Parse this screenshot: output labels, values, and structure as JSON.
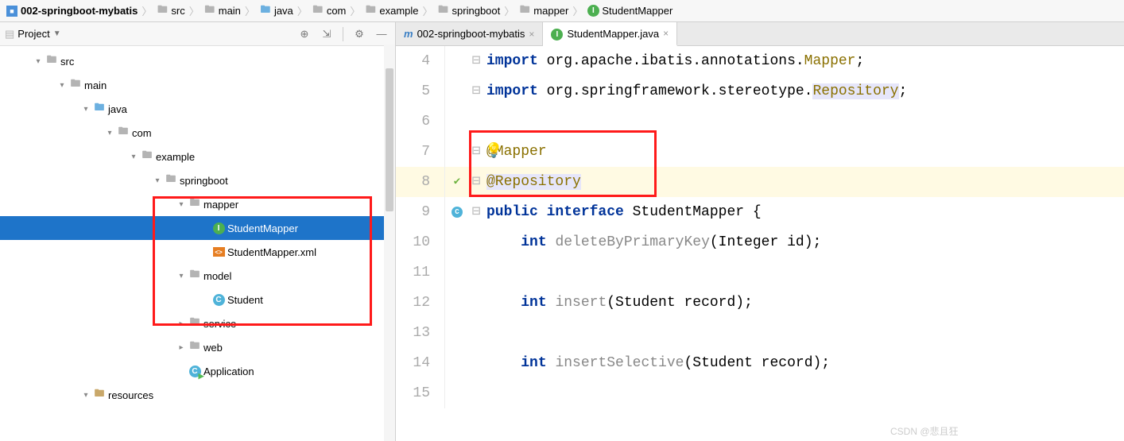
{
  "breadcrumb": [
    {
      "icon": "module",
      "label": "002-springboot-mybatis",
      "bold": true
    },
    {
      "icon": "folder",
      "label": "src"
    },
    {
      "icon": "folder",
      "label": "main"
    },
    {
      "icon": "folder-blue",
      "label": "java"
    },
    {
      "icon": "folder",
      "label": "com"
    },
    {
      "icon": "folder",
      "label": "example"
    },
    {
      "icon": "folder",
      "label": "springboot"
    },
    {
      "icon": "folder",
      "label": "mapper"
    },
    {
      "icon": "interface",
      "label": "StudentMapper"
    }
  ],
  "project_panel": {
    "title": "Project"
  },
  "tree": [
    {
      "depth": 0,
      "arrow": "down",
      "icon": "folder",
      "label": "src"
    },
    {
      "depth": 1,
      "arrow": "down",
      "icon": "folder",
      "label": "main"
    },
    {
      "depth": 2,
      "arrow": "down",
      "icon": "folder-blue",
      "label": "java"
    },
    {
      "depth": 3,
      "arrow": "down",
      "icon": "folder",
      "label": "com"
    },
    {
      "depth": 4,
      "arrow": "down",
      "icon": "folder",
      "label": "example"
    },
    {
      "depth": 5,
      "arrow": "down",
      "icon": "folder",
      "label": "springboot"
    },
    {
      "depth": 6,
      "arrow": "down",
      "icon": "folder",
      "label": "mapper"
    },
    {
      "depth": 7,
      "arrow": "",
      "icon": "interface",
      "label": "StudentMapper",
      "selected": true
    },
    {
      "depth": 7,
      "arrow": "",
      "icon": "xml",
      "label": "StudentMapper.xml"
    },
    {
      "depth": 6,
      "arrow": "down",
      "icon": "folder",
      "label": "model"
    },
    {
      "depth": 7,
      "arrow": "",
      "icon": "class",
      "label": "Student"
    },
    {
      "depth": 6,
      "arrow": "right",
      "icon": "folder",
      "label": "service"
    },
    {
      "depth": 6,
      "arrow": "right",
      "icon": "folder",
      "label": "web"
    },
    {
      "depth": 6,
      "arrow": "",
      "icon": "class-run",
      "label": "Application"
    },
    {
      "depth": 2,
      "arrow": "down",
      "icon": "folder-res",
      "label": "resources"
    }
  ],
  "tabs": [
    {
      "icon": "maven",
      "label": "002-springboot-mybatis",
      "active": false
    },
    {
      "icon": "interface",
      "label": "StudentMapper.java",
      "active": true
    }
  ],
  "code": [
    {
      "n": 4,
      "fold": "-",
      "tokens": [
        {
          "t": "kw",
          "v": "import"
        },
        {
          "t": "txt",
          "v": " org.apache.ibatis.annotations."
        },
        {
          "t": "anno",
          "v": "Mapper"
        },
        {
          "t": "txt",
          "v": ";"
        }
      ]
    },
    {
      "n": 5,
      "fold": "-",
      "tokens": [
        {
          "t": "kw",
          "v": "import"
        },
        {
          "t": "txt",
          "v": " org.springframework.stereotype."
        },
        {
          "t": "anno-hi",
          "v": "Repository"
        },
        {
          "t": "txt",
          "v": ";"
        }
      ]
    },
    {
      "n": 6,
      "tokens": []
    },
    {
      "n": 7,
      "fold": "-",
      "bulb": true,
      "tokens": [
        {
          "t": "anno",
          "v": "@Mapper"
        }
      ]
    },
    {
      "n": 8,
      "fold": "-",
      "current": true,
      "gicon": "spring",
      "tokens": [
        {
          "t": "anno-hi",
          "v": "@Repository"
        }
      ]
    },
    {
      "n": 9,
      "fold": "-",
      "gicon": "c",
      "tokens": [
        {
          "t": "kw",
          "v": "public interface"
        },
        {
          "t": "txt",
          "v": " StudentMapper {"
        }
      ]
    },
    {
      "n": 10,
      "tokens": [
        {
          "t": "txt",
          "v": "    "
        },
        {
          "t": "kw",
          "v": "int"
        },
        {
          "t": "txt",
          "v": " "
        },
        {
          "t": "gray",
          "v": "deleteByPrimaryKey"
        },
        {
          "t": "txt",
          "v": "(Integer id);"
        }
      ]
    },
    {
      "n": 11,
      "tokens": []
    },
    {
      "n": 12,
      "tokens": [
        {
          "t": "txt",
          "v": "    "
        },
        {
          "t": "kw",
          "v": "int"
        },
        {
          "t": "txt",
          "v": " "
        },
        {
          "t": "gray",
          "v": "insert"
        },
        {
          "t": "txt",
          "v": "(Student record);"
        }
      ]
    },
    {
      "n": 13,
      "tokens": []
    },
    {
      "n": 14,
      "tokens": [
        {
          "t": "txt",
          "v": "    "
        },
        {
          "t": "kw",
          "v": "int"
        },
        {
          "t": "txt",
          "v": " "
        },
        {
          "t": "gray",
          "v": "insertSelective"
        },
        {
          "t": "txt",
          "v": "(Student record);"
        }
      ]
    },
    {
      "n": 15,
      "tokens": []
    }
  ],
  "watermark": "CSDN @悲且狂"
}
